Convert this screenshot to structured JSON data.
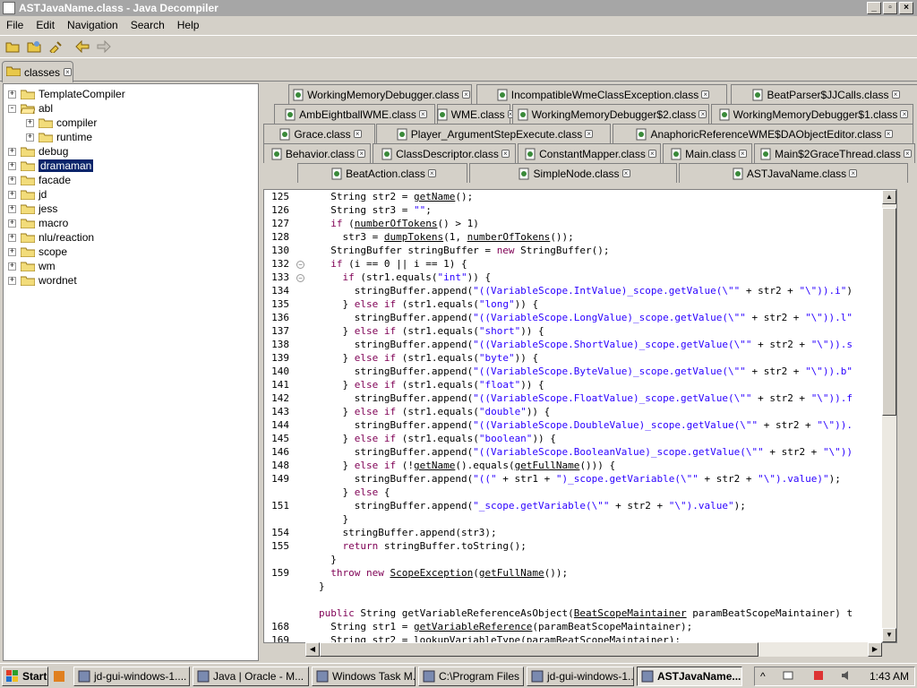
{
  "window": {
    "title": "ASTJavaName.class - Java Decompiler"
  },
  "menu": [
    "File",
    "Edit",
    "Navigation",
    "Search",
    "Help"
  ],
  "toolbar_icons": [
    "open-file-icon",
    "open-type-icon",
    "find-icon",
    "back-icon",
    "forward-icon"
  ],
  "outer_tab": {
    "label": "classes"
  },
  "tree": [
    {
      "label": "TemplateCompiler",
      "depth": 0,
      "expander": "+"
    },
    {
      "label": "abl",
      "depth": 0,
      "expander": "-",
      "open": true
    },
    {
      "label": "compiler",
      "depth": 1,
      "expander": "+"
    },
    {
      "label": "runtime",
      "depth": 1,
      "expander": "+"
    },
    {
      "label": "debug",
      "depth": 0,
      "expander": "+"
    },
    {
      "label": "dramaman",
      "depth": 0,
      "expander": "+",
      "selected": true
    },
    {
      "label": "facade",
      "depth": 0,
      "expander": "+"
    },
    {
      "label": "jd",
      "depth": 0,
      "expander": "+"
    },
    {
      "label": "jess",
      "depth": 0,
      "expander": "+"
    },
    {
      "label": "macro",
      "depth": 0,
      "expander": "+"
    },
    {
      "label": "nlu/reaction",
      "depth": 0,
      "expander": "+"
    },
    {
      "label": "scope",
      "depth": 0,
      "expander": "+"
    },
    {
      "label": "wm",
      "depth": 0,
      "expander": "+"
    },
    {
      "label": "wordnet",
      "depth": 0,
      "expander": "+"
    }
  ],
  "editor_tabs": [
    [
      "WorkingMemoryDebugger.class",
      "IncompatibleWmeClassException.class",
      "BeatParser$JJCalls.class"
    ],
    [
      "AmbEightballWME.class",
      "WME.class",
      "WorkingMemoryDebugger$2.class",
      "WorkingMemoryDebugger$1.class"
    ],
    [
      "Grace.class",
      "Player_ArgumentStepExecute.class",
      "AnaphoricReferenceWME$DAObjectEditor.class"
    ],
    [
      "Behavior.class",
      "ClassDescriptor.class",
      "ConstantMapper.class",
      "Main.class",
      "Main$2GraceThread.class"
    ],
    [
      "BeatAction.class",
      "SimpleNode.class",
      "ASTJavaName.class"
    ]
  ],
  "active_tab": "ASTJavaName.class",
  "code_lines": [
    {
      "n": "125",
      "segs": [
        [
          "p",
          "  String str2 = "
        ],
        [
          "u",
          "getName"
        ],
        [
          "p",
          "();"
        ]
      ]
    },
    {
      "n": "126",
      "segs": [
        [
          "p",
          "  String str3 = "
        ],
        [
          "s",
          "\"\""
        ],
        [
          "p",
          ";"
        ]
      ]
    },
    {
      "n": "127",
      "segs": [
        [
          "p",
          "  "
        ],
        [
          "k",
          "if"
        ],
        [
          "p",
          " ("
        ],
        [
          "u",
          "numberOfTokens"
        ],
        [
          "p",
          "() > 1)"
        ]
      ]
    },
    {
      "n": "128",
      "segs": [
        [
          "p",
          "    str3 = "
        ],
        [
          "u",
          "dumpTokens"
        ],
        [
          "p",
          "(1, "
        ],
        [
          "u",
          "numberOfTokens"
        ],
        [
          "p",
          "());"
        ]
      ]
    },
    {
      "n": "130",
      "segs": [
        [
          "p",
          "  StringBuffer stringBuffer = "
        ],
        [
          "k",
          "new"
        ],
        [
          "p",
          " StringBuffer();"
        ]
      ]
    },
    {
      "n": "132",
      "fold": true,
      "segs": [
        [
          "p",
          "  "
        ],
        [
          "k",
          "if"
        ],
        [
          "p",
          " (i == 0 || i == 1) {"
        ]
      ]
    },
    {
      "n": "133",
      "fold": true,
      "segs": [
        [
          "p",
          "    "
        ],
        [
          "k",
          "if"
        ],
        [
          "p",
          " (str1.equals("
        ],
        [
          "s",
          "\"int\""
        ],
        [
          "p",
          ")) {"
        ]
      ]
    },
    {
      "n": "134",
      "segs": [
        [
          "p",
          "      stringBuffer.append("
        ],
        [
          "s",
          "\"((VariableScope.IntValue)_scope.getValue(\\\"\""
        ],
        [
          "p",
          " + str2 + "
        ],
        [
          "s",
          "\"\\\")).i\""
        ],
        [
          "p",
          ")"
        ]
      ]
    },
    {
      "n": "135",
      "segs": [
        [
          "p",
          "    } "
        ],
        [
          "k",
          "else if"
        ],
        [
          "p",
          " (str1.equals("
        ],
        [
          "s",
          "\"long\""
        ],
        [
          "p",
          ")) {"
        ]
      ]
    },
    {
      "n": "136",
      "segs": [
        [
          "p",
          "      stringBuffer.append("
        ],
        [
          "s",
          "\"((VariableScope.LongValue)_scope.getValue(\\\"\""
        ],
        [
          "p",
          " + str2 + "
        ],
        [
          "s",
          "\"\\\")).l\""
        ]
      ]
    },
    {
      "n": "137",
      "segs": [
        [
          "p",
          "    } "
        ],
        [
          "k",
          "else if"
        ],
        [
          "p",
          " (str1.equals("
        ],
        [
          "s",
          "\"short\""
        ],
        [
          "p",
          ")) {"
        ]
      ]
    },
    {
      "n": "138",
      "segs": [
        [
          "p",
          "      stringBuffer.append("
        ],
        [
          "s",
          "\"((VariableScope.ShortValue)_scope.getValue(\\\"\""
        ],
        [
          "p",
          " + str2 + "
        ],
        [
          "s",
          "\"\\\")).s"
        ]
      ]
    },
    {
      "n": "139",
      "segs": [
        [
          "p",
          "    } "
        ],
        [
          "k",
          "else if"
        ],
        [
          "p",
          " (str1.equals("
        ],
        [
          "s",
          "\"byte\""
        ],
        [
          "p",
          ")) {"
        ]
      ]
    },
    {
      "n": "140",
      "segs": [
        [
          "p",
          "      stringBuffer.append("
        ],
        [
          "s",
          "\"((VariableScope.ByteValue)_scope.getValue(\\\"\""
        ],
        [
          "p",
          " + str2 + "
        ],
        [
          "s",
          "\"\\\")).b\""
        ]
      ]
    },
    {
      "n": "141",
      "segs": [
        [
          "p",
          "    } "
        ],
        [
          "k",
          "else if"
        ],
        [
          "p",
          " (str1.equals("
        ],
        [
          "s",
          "\"float\""
        ],
        [
          "p",
          ")) {"
        ]
      ]
    },
    {
      "n": "142",
      "segs": [
        [
          "p",
          "      stringBuffer.append("
        ],
        [
          "s",
          "\"((VariableScope.FloatValue)_scope.getValue(\\\"\""
        ],
        [
          "p",
          " + str2 + "
        ],
        [
          "s",
          "\"\\\")).f"
        ]
      ]
    },
    {
      "n": "143",
      "segs": [
        [
          "p",
          "    } "
        ],
        [
          "k",
          "else if"
        ],
        [
          "p",
          " (str1.equals("
        ],
        [
          "s",
          "\"double\""
        ],
        [
          "p",
          ")) {"
        ]
      ]
    },
    {
      "n": "144",
      "segs": [
        [
          "p",
          "      stringBuffer.append("
        ],
        [
          "s",
          "\"((VariableScope.DoubleValue)_scope.getValue(\\\"\""
        ],
        [
          "p",
          " + str2 + "
        ],
        [
          "s",
          "\"\\\"))."
        ]
      ]
    },
    {
      "n": "145",
      "segs": [
        [
          "p",
          "    } "
        ],
        [
          "k",
          "else if"
        ],
        [
          "p",
          " (str1.equals("
        ],
        [
          "s",
          "\"boolean\""
        ],
        [
          "p",
          ")) {"
        ]
      ]
    },
    {
      "n": "146",
      "segs": [
        [
          "p",
          "      stringBuffer.append("
        ],
        [
          "s",
          "\"((VariableScope.BooleanValue)_scope.getValue(\\\"\""
        ],
        [
          "p",
          " + str2 + "
        ],
        [
          "s",
          "\"\\\"))"
        ]
      ]
    },
    {
      "n": "148",
      "segs": [
        [
          "p",
          "    } "
        ],
        [
          "k",
          "else if"
        ],
        [
          "p",
          " (!"
        ],
        [
          "u",
          "getName"
        ],
        [
          "p",
          "().equals("
        ],
        [
          "u",
          "getFullName"
        ],
        [
          "p",
          "())) {"
        ]
      ]
    },
    {
      "n": "149",
      "segs": [
        [
          "p",
          "      stringBuffer.append("
        ],
        [
          "s",
          "\"((\""
        ],
        [
          "p",
          " + str1 + "
        ],
        [
          "s",
          "\")_scope.getVariable(\\\"\""
        ],
        [
          "p",
          " + str2 + "
        ],
        [
          "s",
          "\"\\\").value)\""
        ],
        [
          "p",
          ");"
        ]
      ]
    },
    {
      "n": "",
      "segs": [
        [
          "p",
          "    } "
        ],
        [
          "k",
          "else"
        ],
        [
          "p",
          " {"
        ]
      ]
    },
    {
      "n": "151",
      "segs": [
        [
          "p",
          "      stringBuffer.append("
        ],
        [
          "s",
          "\"_scope.getVariable(\\\"\""
        ],
        [
          "p",
          " + str2 + "
        ],
        [
          "s",
          "\"\\\").value\""
        ],
        [
          "p",
          ");"
        ]
      ]
    },
    {
      "n": "",
      "segs": [
        [
          "p",
          "    }"
        ]
      ]
    },
    {
      "n": "154",
      "segs": [
        [
          "p",
          "    stringBuffer.append(str3);"
        ]
      ]
    },
    {
      "n": "155",
      "segs": [
        [
          "p",
          "    "
        ],
        [
          "k",
          "return"
        ],
        [
          "p",
          " stringBuffer.toString();"
        ]
      ]
    },
    {
      "n": "",
      "segs": [
        [
          "p",
          "  }"
        ]
      ]
    },
    {
      "n": "159",
      "segs": [
        [
          "p",
          "  "
        ],
        [
          "k",
          "throw new"
        ],
        [
          "p",
          " "
        ],
        [
          "u",
          "ScopeException"
        ],
        [
          "p",
          "("
        ],
        [
          "u",
          "getFullName"
        ],
        [
          "p",
          "());"
        ]
      ]
    },
    {
      "n": "",
      "segs": [
        [
          "p",
          "}"
        ]
      ]
    },
    {
      "n": "",
      "segs": [
        [
          "p",
          ""
        ]
      ]
    },
    {
      "n": "",
      "segs": [
        [
          "k",
          "public"
        ],
        [
          "p",
          " String getVariableReferenceAsObject("
        ],
        [
          "u",
          "BeatScopeMaintainer"
        ],
        [
          "p",
          " paramBeatScopeMaintainer) t"
        ]
      ]
    },
    {
      "n": "168",
      "segs": [
        [
          "p",
          "  String str1 = "
        ],
        [
          "u",
          "getVariableReference"
        ],
        [
          "p",
          "(paramBeatScopeMaintainer);"
        ]
      ]
    },
    {
      "n": "169",
      "segs": [
        [
          "p",
          "  String str2 = lookupVariableType(paramBeatScopeMaintainer);"
        ]
      ]
    }
  ],
  "taskbar": {
    "start": "Start",
    "tasks": [
      "jd-gui-windows-1....",
      "Java | Oracle - M...",
      "Windows Task M...",
      "C:\\Program Files ...",
      "jd-gui-windows-1....",
      "ASTJavaName...."
    ],
    "active_task": 5,
    "clock": "1:43 AM"
  },
  "colors": {
    "keyword": "#7f0055",
    "string": "#2a00ff",
    "selection": "#0a246a"
  }
}
